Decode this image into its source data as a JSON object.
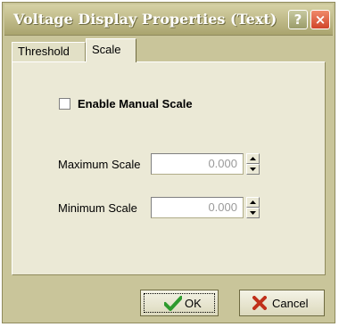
{
  "window": {
    "title": "Voltage Display Properties (Text)",
    "help_label": "?",
    "close_label": "×"
  },
  "tabs": [
    {
      "label": "Threshold",
      "selected": false
    },
    {
      "label": "Scale",
      "selected": true
    }
  ],
  "scale_tab": {
    "enable_manual_scale": {
      "label": "Enable Manual Scale",
      "checked": false
    },
    "maximum_scale": {
      "label": "Maximum Scale",
      "value": "0.000",
      "disabled": true
    },
    "minimum_scale": {
      "label": "Minimum Scale",
      "value": "0.000",
      "disabled": true
    }
  },
  "buttons": {
    "ok_label": "OK",
    "cancel_label": "Cancel"
  },
  "icons": {
    "help": "question-mark-icon",
    "close": "close-x-icon",
    "ok": "green-checkmark-icon",
    "cancel": "red-x-icon",
    "spin_up": "arrow-up-icon",
    "spin_down": "arrow-down-icon"
  },
  "colors": {
    "dialog_bg": "#c9c59a",
    "panel_bg": "#ebe9d6",
    "close_red": "#d0452a",
    "ok_green": "#2e9a2e",
    "cancel_red": "#c0301a"
  }
}
